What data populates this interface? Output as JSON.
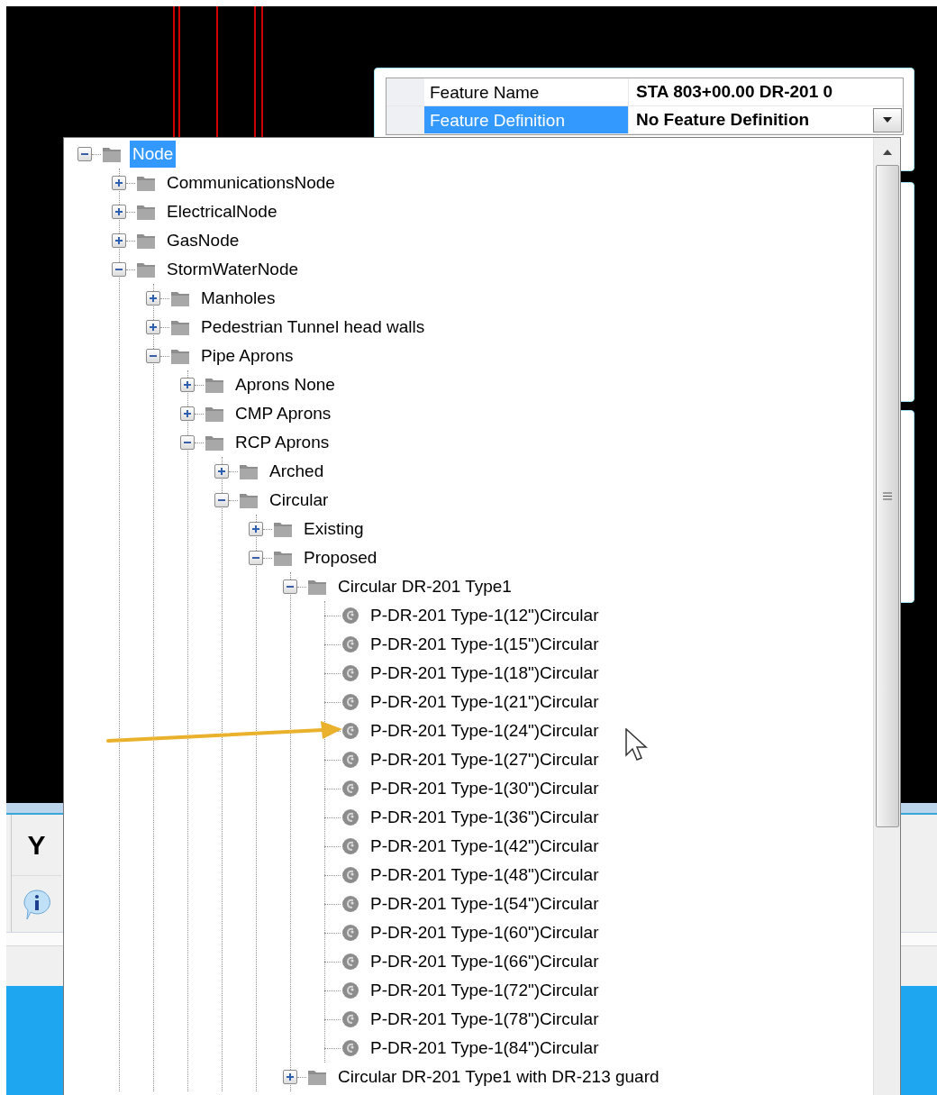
{
  "property_grid": {
    "rows": [
      {
        "label": "Feature Name",
        "value": "STA 803+00.00 DR-201 0",
        "selected": false,
        "dropdown": false
      },
      {
        "label": "Feature Definition",
        "value": "No Feature Definition",
        "selected": true,
        "dropdown": true
      }
    ]
  },
  "side_panel": {
    "label": "Y"
  },
  "tree": {
    "nodes": [
      {
        "label": "Node",
        "kind": "folder",
        "expanded": true,
        "selected": true,
        "children": [
          {
            "label": "CommunicationsNode",
            "kind": "folder",
            "expanded": false,
            "selected": false
          },
          {
            "label": "ElectricalNode",
            "kind": "folder",
            "expanded": false,
            "selected": false
          },
          {
            "label": "GasNode",
            "kind": "folder",
            "expanded": false,
            "selected": false
          },
          {
            "label": "StormWaterNode",
            "kind": "folder",
            "expanded": true,
            "selected": false,
            "children": [
              {
                "label": "Manholes",
                "kind": "folder",
                "expanded": false,
                "selected": false
              },
              {
                "label": "Pedestrian Tunnel head walls",
                "kind": "folder",
                "expanded": false,
                "selected": false
              },
              {
                "label": "Pipe Aprons",
                "kind": "folder",
                "expanded": true,
                "selected": false,
                "children": [
                  {
                    "label": "Aprons None",
                    "kind": "folder",
                    "expanded": false,
                    "selected": false
                  },
                  {
                    "label": "CMP Aprons",
                    "kind": "folder",
                    "expanded": false,
                    "selected": false
                  },
                  {
                    "label": "RCP Aprons",
                    "kind": "folder",
                    "expanded": true,
                    "selected": false,
                    "children": [
                      {
                        "label": "Arched",
                        "kind": "folder",
                        "expanded": false,
                        "selected": false
                      },
                      {
                        "label": "Circular",
                        "kind": "folder",
                        "expanded": true,
                        "selected": false,
                        "children": [
                          {
                            "label": "Existing",
                            "kind": "folder",
                            "expanded": false,
                            "selected": false
                          },
                          {
                            "label": "Proposed",
                            "kind": "folder",
                            "expanded": true,
                            "selected": false,
                            "children": [
                              {
                                "label": "Circular DR-201 Type1",
                                "kind": "folder",
                                "expanded": true,
                                "selected": false,
                                "children": [
                                  {
                                    "label": "P-DR-201 Type-1(12\")Circular",
                                    "kind": "item",
                                    "selected": false
                                  },
                                  {
                                    "label": "P-DR-201 Type-1(15\")Circular",
                                    "kind": "item",
                                    "selected": false
                                  },
                                  {
                                    "label": "P-DR-201 Type-1(18\")Circular",
                                    "kind": "item",
                                    "selected": false
                                  },
                                  {
                                    "label": "P-DR-201 Type-1(21\")Circular",
                                    "kind": "item",
                                    "selected": false
                                  },
                                  {
                                    "label": "P-DR-201 Type-1(24\")Circular",
                                    "kind": "item",
                                    "selected": false
                                  },
                                  {
                                    "label": "P-DR-201 Type-1(27\")Circular",
                                    "kind": "item",
                                    "selected": false
                                  },
                                  {
                                    "label": "P-DR-201 Type-1(30\")Circular",
                                    "kind": "item",
                                    "selected": false
                                  },
                                  {
                                    "label": "P-DR-201 Type-1(36\")Circular",
                                    "kind": "item",
                                    "selected": false
                                  },
                                  {
                                    "label": "P-DR-201 Type-1(42\")Circular",
                                    "kind": "item",
                                    "selected": false
                                  },
                                  {
                                    "label": "P-DR-201 Type-1(48\")Circular",
                                    "kind": "item",
                                    "selected": false
                                  },
                                  {
                                    "label": "P-DR-201 Type-1(54\")Circular",
                                    "kind": "item",
                                    "selected": false
                                  },
                                  {
                                    "label": "P-DR-201 Type-1(60\")Circular",
                                    "kind": "item",
                                    "selected": false
                                  },
                                  {
                                    "label": "P-DR-201 Type-1(66\")Circular",
                                    "kind": "item",
                                    "selected": false
                                  },
                                  {
                                    "label": "P-DR-201 Type-1(72\")Circular",
                                    "kind": "item",
                                    "selected": false
                                  },
                                  {
                                    "label": "P-DR-201 Type-1(78\")Circular",
                                    "kind": "item",
                                    "selected": false
                                  },
                                  {
                                    "label": "P-DR-201 Type-1(84\")Circular",
                                    "kind": "item",
                                    "selected": false
                                  }
                                ]
                              },
                              {
                                "label": "Circular DR-201 Type1 with DR-213 guard",
                                "kind": "folder",
                                "expanded": false,
                                "selected": false
                              }
                            ]
                          }
                        ]
                      }
                    ]
                  }
                ]
              }
            ]
          }
        ]
      }
    ]
  }
}
